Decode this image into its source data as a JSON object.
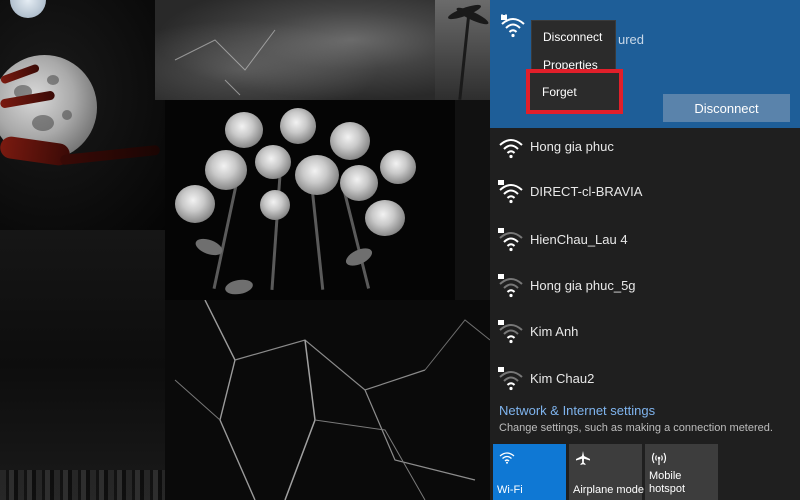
{
  "context_menu": {
    "items": [
      "Disconnect",
      "Properties",
      "Forget"
    ],
    "highlighted": "Forget"
  },
  "connected_network": {
    "status_suffix": "ured",
    "disconnect_label": "Disconnect"
  },
  "networks": [
    {
      "ssid": "Hong gia phuc",
      "secured": false
    },
    {
      "ssid": "DIRECT-cl-BRAVIA",
      "secured": true
    },
    {
      "ssid": "HienChau_Lau 4",
      "secured": true
    },
    {
      "ssid": "Hong gia phuc_5g",
      "secured": true
    },
    {
      "ssid": "Kim Anh",
      "secured": true
    },
    {
      "ssid": "Kim Chau2",
      "secured": true
    }
  ],
  "settings": {
    "link": "Network & Internet settings",
    "description": "Change settings, such as making a connection metered."
  },
  "quick_actions": [
    {
      "label": "Wi-Fi",
      "icon": "wifi-icon",
      "active": true
    },
    {
      "label": "Airplane mode",
      "icon": "airplane-icon",
      "active": false
    },
    {
      "label_line1": "Mobile",
      "label_line2": "hotspot",
      "icon": "hotspot-icon",
      "active": false
    }
  ],
  "colors": {
    "accent": "#0f78d4",
    "connected_bg": "#1e5e98",
    "flyout_bg": "#1f1f1f",
    "highlight_border": "#e11f2a",
    "link": "#7fb4ee"
  }
}
